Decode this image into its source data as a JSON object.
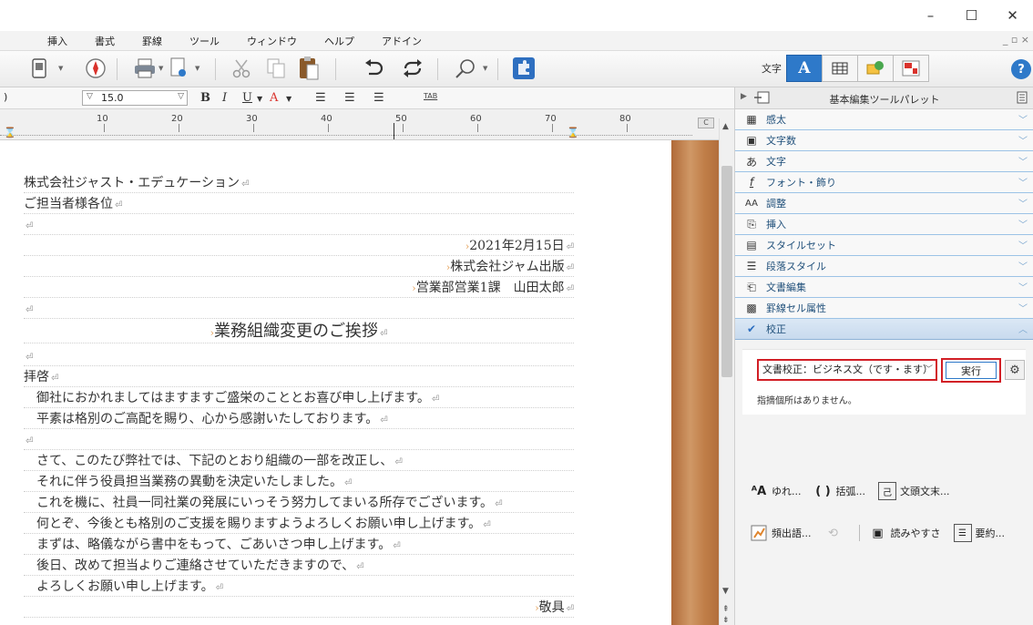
{
  "menu": {
    "items": [
      "挿入",
      "書式",
      "罫線",
      "ツール",
      "ウィンドウ",
      "ヘルプ",
      "アドイン"
    ]
  },
  "toolbar": {
    "mode_label": "文字",
    "mode_a": "A",
    "help": "?"
  },
  "format": {
    "font_paren": ")",
    "font_size": "15.0",
    "tab_label": "TAB"
  },
  "ruler": {
    "ticks": [
      "10",
      "20",
      "30",
      "40",
      "50",
      "60",
      "70",
      "80"
    ],
    "corner": "C"
  },
  "doc": {
    "pm": "⏎",
    "lines": [
      "株式会社ジャスト・エデュケーション",
      "ご担当者様各位",
      "",
      "2021年2月15日",
      "株式会社ジャム出版",
      "営業部営業1課　山田太郎",
      "",
      "業務組織変更のご挨拶",
      "",
      "拝啓",
      "御社におかれましてはますますご盛栄のこととお喜び申し上げます。",
      "平素は格別のご高配を賜り、心から感謝いたしております。",
      "",
      "さて、このたび弊社では、下記のとおり組織の一部を改正し、",
      "それに伴う役員担当業務の異動を決定いたしました。",
      "これを機に、社員一同社業の発展にいっそう努力してまいる所存でございます。",
      "何とぞ、今後とも格別のご支援を賜りますようよろしくお願い申し上げます。",
      "まずは、略儀ながら書中をもって、ごあいさつ申し上げます。",
      "後日、改めて担当よりご連絡させていただきますので、",
      "よろしくお願い申し上げます。",
      "敬具"
    ]
  },
  "panel": {
    "title": "基本編集ツールパレット",
    "sections": [
      "感太",
      "文字数",
      "文字",
      "フォント・飾り",
      "調整",
      "挿入",
      "スタイルセット",
      "段落スタイル",
      "文書編集",
      "罫線セル属性",
      "校正"
    ],
    "check": {
      "mode_value": "文書校正：ビジネス文（です・ます）",
      "run_label": "実行",
      "notice": "指摘個所はありません。",
      "tools_row1": [
        "ゆれ...",
        "括弧...",
        "文頭文末..."
      ],
      "tools_row2": [
        "頻出語...",
        "読みやすさ",
        "要約..."
      ]
    }
  }
}
